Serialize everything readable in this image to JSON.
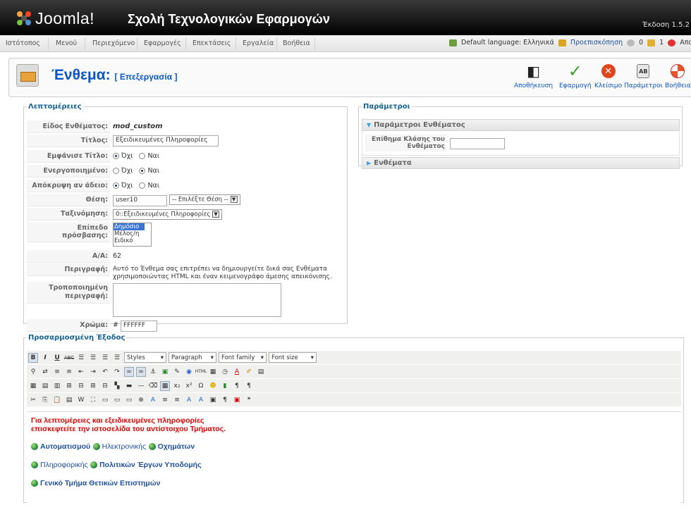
{
  "header": {
    "brand": "Joomla!",
    "site_name": "Σχολή Τεχνολογικών Εφαρμογών",
    "version": "Έκδοση 1.5.2"
  },
  "menu": [
    "Ιστότοπος",
    "Μενού",
    "Περιεχόμενο",
    "Εφαρμογές",
    "Επεκτάσεις",
    "Εργαλεία",
    "Βοήθεια"
  ],
  "status": {
    "default_language": "Default language: Ελληνικά",
    "preview": "Προεπισκόπηση",
    "messages": "0",
    "users": "1",
    "logout": "Αποσύνδεση"
  },
  "toolbar": {
    "title": "Ένθεμα:",
    "subtitle": "[ Επεξεργασία ]",
    "buttons": {
      "save": "Αποθήκευση",
      "apply": "Εφαρμογή",
      "close": "Κλείσιμο",
      "params": "Παράμετροι",
      "help": "Βοήθεια"
    }
  },
  "details": {
    "legend": "Λεπτομέρειες",
    "type_label": "Είδος Ενθέματος:",
    "type_value": "mod_custom",
    "title_label": "Τίτλος:",
    "title_value": "Εξειδικευμένες Πληροφορίες",
    "show_title_label": "Εμφάνισε Τίτλο:",
    "enabled_label": "Ενεργοποιημένο:",
    "hide_empty_label": "Απόκρυψη αν άδειο:",
    "no": "Όχι",
    "yes": "Ναι",
    "position_label": "Θέση:",
    "position_value": "user10",
    "position_select": "-- Επιλέξτε Θέση --",
    "order_label": "Ταξινόμηση:",
    "order_value": "0::Εξειδικευμένες Πληροφορίες",
    "access_label": "Επίπεδο πρόσβασης:",
    "access_options": [
      "Δημόσιο",
      "Μέλος/η",
      "Ειδικό"
    ],
    "id_label": "Α/Α:",
    "id_value": "62",
    "description_label": "Περιγραφή:",
    "description_value": "Αυτό το Ένθεμα σας επιτρέπει να δημιουργείτε δικά σας Ενθέματα χρησιμοποιώντας HTML και έναν κειμενογράφο άμεσης απεικόνισης.",
    "custom_desc_label": "Τροποποιημένη περιγραφή:",
    "color_label": "Χρώμα:",
    "color_prefix": "#",
    "color_value": "FFFFFF"
  },
  "params": {
    "legend": "Παράμετροι",
    "section1": "Παράμετροι Ενθέματος",
    "suffix_label": "Επίθημα Κλάσης του Ενθέματος",
    "section2": "Ενθέματα"
  },
  "output": {
    "legend": "Προσαρμοσμένη Έξοδος",
    "styles": "Styles",
    "paragraph": "Paragraph",
    "font_family": "Font family",
    "font_size": "Font size",
    "red_line1": "Για λεπτομέρειες και εξειδικευμένες πληροφορίες",
    "red_line2": "επισκεφτείτε την ιστοσελίδα του αντίστοιχου Τμήματος.",
    "links": [
      {
        "text": "Αυτοματισμού",
        "bold": true
      },
      {
        "text": "Ηλεκτρονικής",
        "bold": false
      },
      {
        "text": "Οχημάτων",
        "bold": true
      },
      {
        "text": "Πληροφορικής",
        "bold": false
      },
      {
        "text": "Πολιτικών Έργων Υποδομής",
        "bold": true
      },
      {
        "text": "Γενικό Τμήμα Θετικών Επιστημών",
        "bold": true
      }
    ]
  }
}
